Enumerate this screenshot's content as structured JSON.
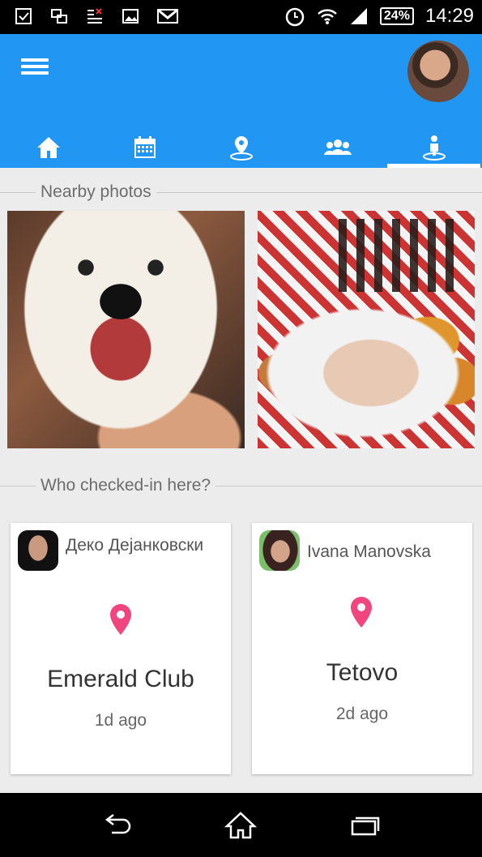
{
  "status_bar": {
    "battery": "24%",
    "time": "14:29",
    "left_icons": [
      "checkbox-icon",
      "screens-icon",
      "signal-mute-icon",
      "image-icon",
      "gmail-icon"
    ],
    "right_icons": [
      "alarm-icon",
      "wifi-icon",
      "cell-signal-icon"
    ]
  },
  "app_bar": {
    "menu_icon": "hamburger-icon",
    "tabs": [
      {
        "name": "home",
        "icon": "home-icon"
      },
      {
        "name": "calendar",
        "icon": "calendar-icon"
      },
      {
        "name": "location",
        "icon": "location-icon"
      },
      {
        "name": "people",
        "icon": "people-icon"
      },
      {
        "name": "checkin",
        "icon": "person-pin-icon",
        "active": true
      }
    ],
    "accent_color": "#2196f3"
  },
  "nearby": {
    "title": "Nearby photos"
  },
  "checkins": {
    "title": "Who checked-in here?",
    "items": [
      {
        "user": "Деко Дејанковски",
        "place": "Emerald Club",
        "time": "1d ago"
      },
      {
        "user": "Ivana Manovska",
        "place": "Tetovo",
        "time": "2d ago"
      }
    ],
    "pin_color": "#f0457f"
  },
  "nav_bar": {
    "buttons": [
      "back-icon",
      "home-icon",
      "recent-apps-icon"
    ]
  }
}
